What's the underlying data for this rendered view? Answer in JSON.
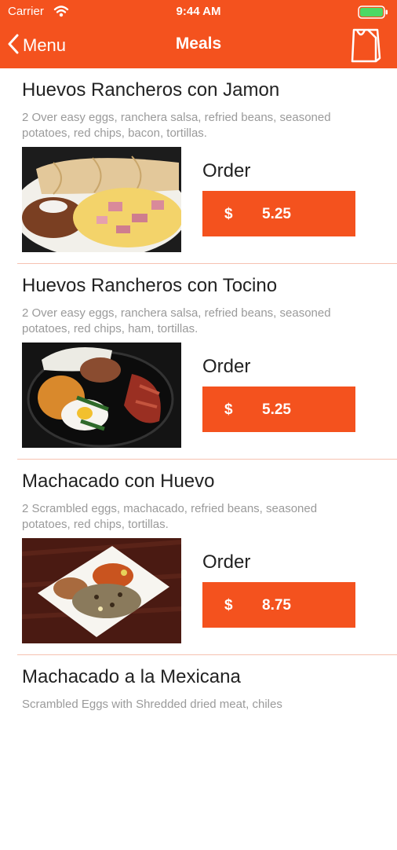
{
  "status": {
    "carrier": "Carrier",
    "time": "9:44 AM"
  },
  "nav": {
    "back_label": "Menu",
    "title": "Meals"
  },
  "colors": {
    "accent": "#f4521e",
    "divider": "#f6c2b1"
  },
  "order_label": "Order",
  "currency": "$",
  "items": [
    {
      "title": "Huevos Rancheros con  Jamon",
      "description": "2 Over easy eggs, ranchera salsa, refried beans, seasoned potatoes, red chips, bacon, tortillas.",
      "price": "5.25"
    },
    {
      "title": "Huevos Rancheros con Tocino",
      "description": "2 Over easy eggs, ranchera salsa, refried beans, seasoned potatoes, red chips,  ham, tortillas.",
      "price": "5.25"
    },
    {
      "title": "Machacado con Huevo",
      "description": "2 Scrambled eggs, machacado, refried beans, seasoned potatoes, red chips,  tortillas.",
      "price": "8.75"
    },
    {
      "title": "Machacado a la Mexicana",
      "description": "Scrambled Eggs with Shredded dried meat, chiles"
    }
  ]
}
